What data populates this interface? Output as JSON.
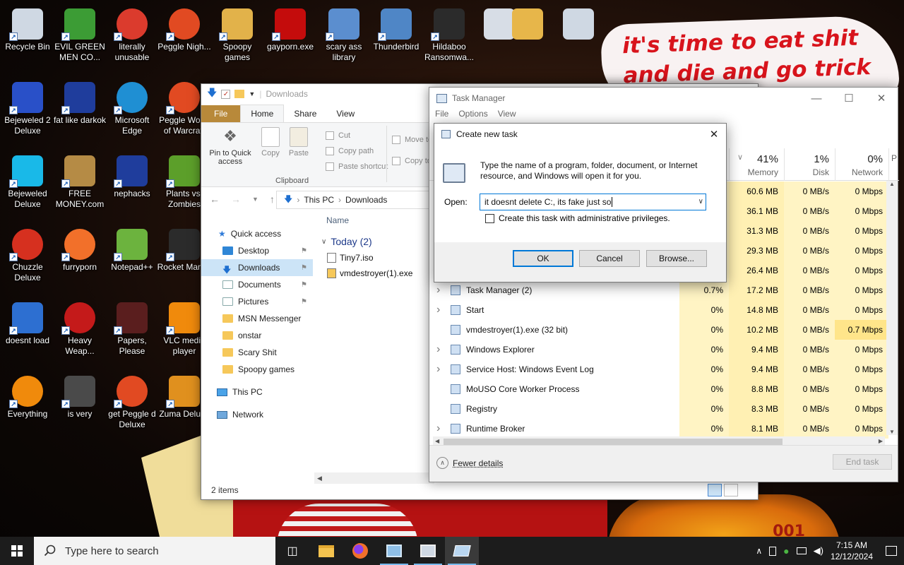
{
  "wallpaper": {
    "meme_line1": "it's time to eat shit",
    "meme_line2": "and die and go trick",
    "badge": "001"
  },
  "desktop_icons": [
    {
      "label": "Recycle Bin",
      "icon": "recycle-bin-icon",
      "color": "#cfd8e3"
    },
    {
      "label": "EVIL GREEN MEN CO...",
      "icon": "msn-buddies-icon",
      "color": "#3c9c35"
    },
    {
      "label": "literally unusable",
      "icon": "chrome-icon",
      "color": "#db3b2d"
    },
    {
      "label": "Peggle Nigh...",
      "icon": "peggle-icon",
      "color": "#e14a22"
    },
    {
      "label": "Spoopy games",
      "icon": "folder-icon",
      "color": "#e2b24a"
    },
    {
      "label": "gayporn.exe",
      "icon": "flash-icon",
      "color": "#c40c0c"
    },
    {
      "label": "scary ass library",
      "icon": "network-computers-icon",
      "color": "#5b8ecf"
    },
    {
      "label": "Thunderbird",
      "icon": "network-icon",
      "color": "#4f86c6"
    },
    {
      "label": "Hildaboo Ransomwa...",
      "icon": "shield-icon",
      "color": "#2b2b2b"
    },
    {
      "label": "Bejeweled 2 Deluxe",
      "icon": "bejeweled-icon",
      "color": "#2950c8"
    },
    {
      "label": "fat like darkok",
      "icon": "mpi-icon",
      "color": "#1f3d9c"
    },
    {
      "label": "Microsoft Edge",
      "icon": "edge-icon",
      "color": "#1f8fd3"
    },
    {
      "label": "Peggle World of Warcraft",
      "icon": "peggle-icon",
      "color": "#e14a22"
    },
    {
      "label": "Bejeweled Deluxe",
      "icon": "diamond-icon",
      "color": "#19b9e8"
    },
    {
      "label": "FREE MONEY.com",
      "icon": "money-bag-icon",
      "color": "#b58b45"
    },
    {
      "label": "nephacks",
      "icon": "mpi-icon",
      "color": "#1f3d9c"
    },
    {
      "label": "Plants vs. Zombies",
      "icon": "plants-icon",
      "color": "#5c9f2a"
    },
    {
      "label": "Chuzzle Deluxe",
      "icon": "chuzzle-icon",
      "color": "#d6301f"
    },
    {
      "label": "furryporn",
      "icon": "firefox-icon",
      "color": "#f2702a"
    },
    {
      "label": "Notepad++",
      "icon": "notepad-icon",
      "color": "#6cb33e"
    },
    {
      "label": "Rocket Mani...",
      "icon": "rocket-icon",
      "color": "#2b2b2b"
    },
    {
      "label": "doesnt load",
      "icon": "thunderbird-icon",
      "color": "#2d6fd1"
    },
    {
      "label": "Heavy Weap...",
      "icon": "radiation-icon",
      "color": "#c41a1a"
    },
    {
      "label": "Papers, Please",
      "icon": "papers-please-icon",
      "color": "#5a1e1e"
    },
    {
      "label": "VLC media player",
      "icon": "vlc-icon",
      "color": "#f08a0c"
    },
    {
      "label": "Everything",
      "icon": "search-icon",
      "color": "#f08a0c"
    },
    {
      "label": "is very",
      "icon": "mpi-icon",
      "color": "#4a4a4a"
    },
    {
      "label": "get Peggle d Deluxe",
      "icon": "peggle-icon",
      "color": "#e14a22"
    },
    {
      "label": "Zuma Deluxe",
      "icon": "zuma-icon",
      "color": "#e0901e"
    },
    {
      "label": "",
      "icon": "computer-icon",
      "color": "#d7dde6"
    },
    {
      "label": "",
      "icon": "folder-icon",
      "color": "#e7b64a"
    },
    {
      "label": "",
      "icon": "recycle-bin-icon",
      "color": "#cfd8e3"
    }
  ],
  "explorer": {
    "title": "Downloads",
    "tabs": [
      "File",
      "Home",
      "Share",
      "View"
    ],
    "ribbon": {
      "pin": "Pin to Quick access",
      "copy": "Copy",
      "paste": "Paste",
      "cut": "Cut",
      "copy_path": "Copy path",
      "paste_shortcut": "Paste shortcut",
      "clipboard": "Clipboard",
      "move_to": "Move to",
      "copy_to": "Copy to"
    },
    "address": [
      "This PC",
      "Downloads"
    ],
    "sidebar": [
      {
        "label": "Quick access",
        "type": "star"
      },
      {
        "label": "Desktop",
        "type": "pinned"
      },
      {
        "label": "Downloads",
        "type": "pinned"
      },
      {
        "label": "Documents",
        "type": "pinned"
      },
      {
        "label": "Pictures",
        "type": "pinned"
      },
      {
        "label": "MSN Messenger",
        "type": "folder"
      },
      {
        "label": "onstar",
        "type": "folder"
      },
      {
        "label": "Scary Shit",
        "type": "folder"
      },
      {
        "label": "Spoopy games",
        "type": "folder"
      },
      {
        "label": "This PC",
        "type": "pc"
      },
      {
        "label": "Network",
        "type": "network"
      }
    ],
    "column_name": "Name",
    "group": "Today (2)",
    "files": [
      "Tiny7.iso",
      "vmdestroyer(1).exe"
    ],
    "status": "2 items"
  },
  "task_manager": {
    "title": "Task Manager",
    "menu": [
      "File",
      "Options",
      "View"
    ],
    "columns": [
      {
        "pct": "41%",
        "name": "Memory"
      },
      {
        "pct": "1%",
        "name": "Disk"
      },
      {
        "pct": "0%",
        "name": "Network"
      },
      {
        "pct": "",
        "name": "P"
      }
    ],
    "rows": [
      {
        "name": "",
        "cpu": "",
        "mem": "60.6 MB",
        "disk": "0 MB/s",
        "net": "0 Mbps"
      },
      {
        "name": "",
        "cpu": "",
        "mem": "36.1 MB",
        "disk": "0 MB/s",
        "net": "0 Mbps"
      },
      {
        "name": "",
        "cpu": "",
        "mem": "31.3 MB",
        "disk": "0 MB/s",
        "net": "0 Mbps"
      },
      {
        "name": "",
        "cpu": "",
        "mem": "29.3 MB",
        "disk": "0 MB/s",
        "net": "0 Mbps"
      },
      {
        "name": "",
        "cpu": "",
        "mem": "26.4 MB",
        "disk": "0 MB/s",
        "net": "0 Mbps"
      },
      {
        "name": "Task Manager (2)",
        "cpu": "0.7%",
        "mem": "17.2 MB",
        "disk": "0 MB/s",
        "net": "0 Mbps",
        "expand": true
      },
      {
        "name": "Start",
        "cpu": "0%",
        "mem": "14.8 MB",
        "disk": "0 MB/s",
        "net": "0 Mbps",
        "expand": true
      },
      {
        "name": "vmdestroyer(1).exe (32 bit)",
        "cpu": "0%",
        "mem": "10.2 MB",
        "disk": "0 MB/s",
        "net": "0.7 Mbps"
      },
      {
        "name": "Windows Explorer",
        "cpu": "0%",
        "mem": "9.4 MB",
        "disk": "0 MB/s",
        "net": "0 Mbps",
        "expand": true
      },
      {
        "name": "Service Host: Windows Event Log",
        "cpu": "0%",
        "mem": "9.4 MB",
        "disk": "0 MB/s",
        "net": "0 Mbps",
        "expand": true
      },
      {
        "name": "MoUSO Core Worker Process",
        "cpu": "0%",
        "mem": "8.8 MB",
        "disk": "0 MB/s",
        "net": "0 Mbps"
      },
      {
        "name": "Registry",
        "cpu": "0%",
        "mem": "8.3 MB",
        "disk": "0 MB/s",
        "net": "0 Mbps"
      },
      {
        "name": "Runtime Broker",
        "cpu": "0%",
        "mem": "8.1 MB",
        "disk": "0 MB/s",
        "net": "0 Mbps",
        "expand": true
      }
    ],
    "fewer_details": "Fewer details",
    "end_task": "End task"
  },
  "run_dialog": {
    "title": "Create new task",
    "description": "Type the name of a program, folder, document, or Internet resource, and Windows will open it for you.",
    "open_label": "Open:",
    "input_value": "it doesnt delete C:, its fake just so",
    "admin_checkbox": "Create this task with administrative privileges.",
    "ok": "OK",
    "cancel": "Cancel",
    "browse": "Browse..."
  },
  "taskbar": {
    "search_placeholder": "Type here to search",
    "time": "7:15 AM",
    "date": "12/12/2024"
  }
}
